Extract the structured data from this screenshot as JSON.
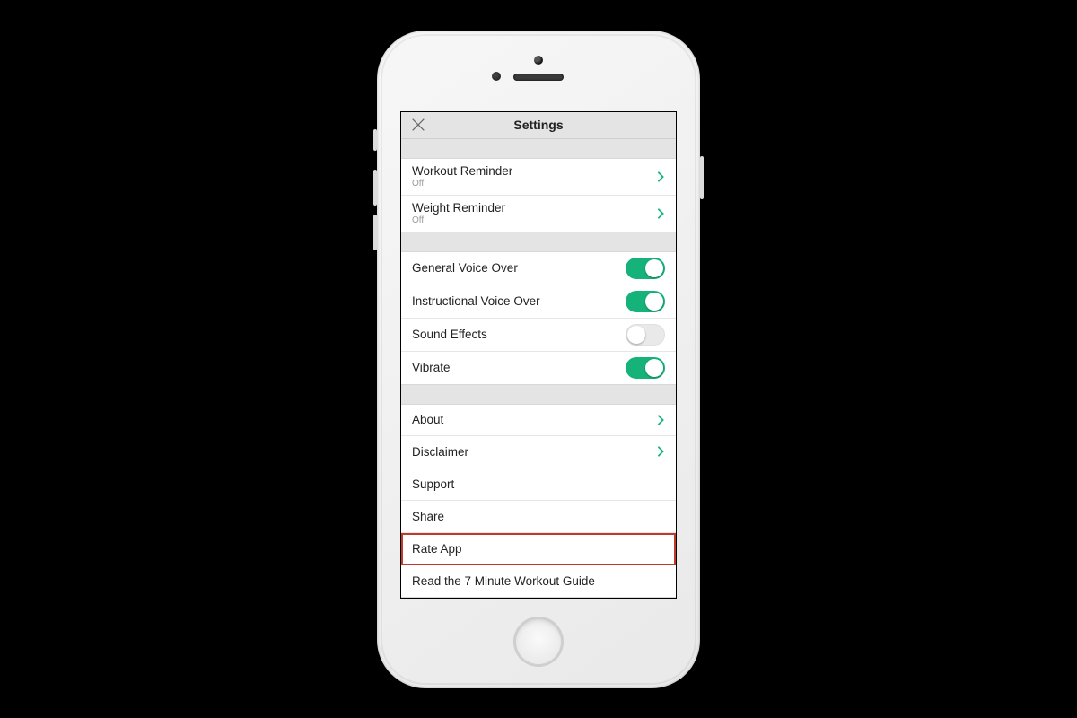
{
  "header": {
    "title": "Settings"
  },
  "reminders": [
    {
      "title": "Workout Reminder",
      "sub": "Off"
    },
    {
      "title": "Weight Reminder",
      "sub": "Off"
    }
  ],
  "audio": [
    {
      "title": "General Voice Over",
      "on": true
    },
    {
      "title": "Instructional Voice Over",
      "on": true
    },
    {
      "title": "Sound Effects",
      "on": false
    },
    {
      "title": "Vibrate",
      "on": true
    }
  ],
  "info": [
    {
      "title": "About",
      "chevron": true
    },
    {
      "title": "Disclaimer",
      "chevron": true
    },
    {
      "title": "Support",
      "chevron": false
    },
    {
      "title": "Share",
      "chevron": false
    },
    {
      "title": "Rate App",
      "chevron": false,
      "highlighted": true
    },
    {
      "title": "Read the 7 Minute Workout Guide",
      "chevron": false
    }
  ],
  "colors": {
    "accent": "#15b37a",
    "highlight": "#c0392b"
  }
}
